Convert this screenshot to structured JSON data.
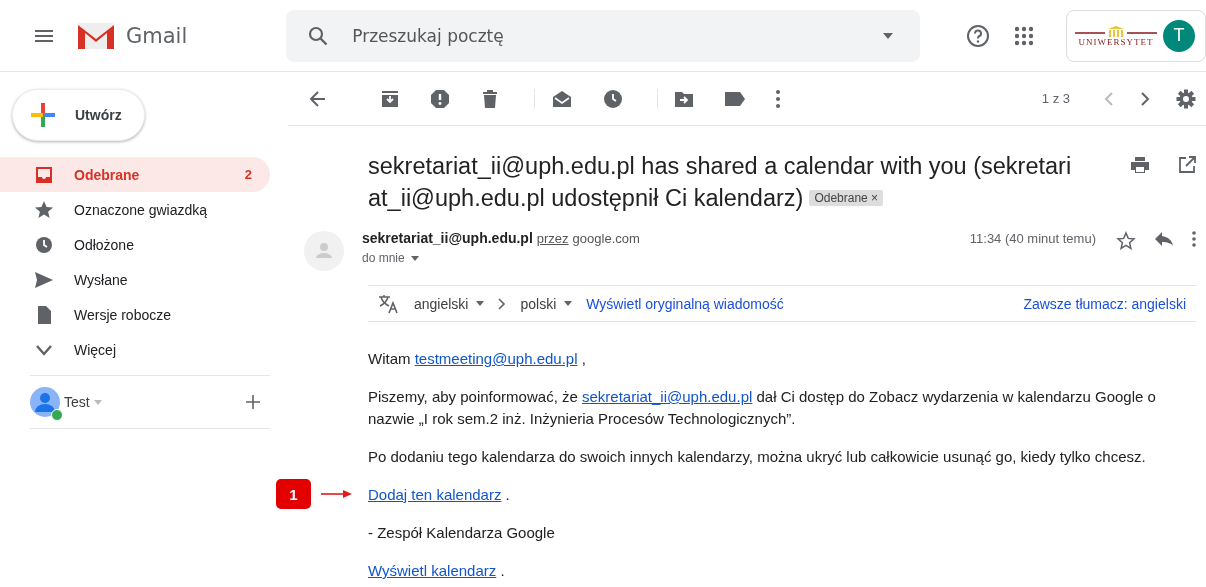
{
  "app": {
    "name": "Gmail"
  },
  "search": {
    "placeholder": "Przeszukaj pocztę"
  },
  "account": {
    "logo_text": "UNIWERSYTET",
    "avatar_initial": "T"
  },
  "compose": {
    "label": "Utwórz"
  },
  "sidebar": {
    "items": [
      {
        "label": "Odebrane",
        "count": "2",
        "selected": true
      },
      {
        "label": "Oznaczone gwiazdką",
        "selected": false
      },
      {
        "label": "Odłożone",
        "selected": false
      },
      {
        "label": "Wysłane",
        "selected": false
      },
      {
        "label": "Wersje robocze",
        "selected": false
      },
      {
        "label": "Więcej",
        "selected": false
      }
    ],
    "hangouts": {
      "user": "Test",
      "online": true
    }
  },
  "pager": "1 z 3",
  "email": {
    "subject_lines": [
      "sekretariat_ii@uph.edu.pl has shared a calendar with you (sekretari",
      "at_ii@uph.edu.pl udostępnił Ci kalendarz)"
    ],
    "label_chip": "Odebrane",
    "label_chip_close": "×",
    "sender": "sekretariat_ii@uph.edu.pl",
    "via_label": "przez",
    "via_domain": "google.com",
    "recipient": "do mnie",
    "time": "11:34 (40 minut temu)",
    "translation": {
      "from": "angielski",
      "to": "polski",
      "show_original": "Wyświetl oryginalną wiadomość",
      "always": "Zawsze tłumacz: angielski"
    },
    "paragraphs": [
      {
        "parts": [
          {
            "text": "Witam "
          },
          {
            "link": "testmeeting@uph.edu.pl"
          },
          {
            "text": " ,"
          }
        ]
      },
      {
        "parts": [
          {
            "text": "Piszemy, aby poinformować, że "
          },
          {
            "link": "sekretariat_ii@uph.edu.pl"
          },
          {
            "text": " dał Ci dostęp do Zobacz wydarzenia w kalendarzu Google o nazwie „I rok sem.2 inż. Inżynieria Procesów Technologicznych”."
          }
        ]
      },
      {
        "parts": [
          {
            "text": "Po dodaniu tego kalendarza do swoich innych kalendarzy, można ukryć lub całkowicie usunąć go, kiedy tylko chcesz."
          }
        ]
      },
      {
        "annotation": "1",
        "parts": [
          {
            "link": "Dodaj ten kalendarz"
          },
          {
            "text": " ."
          }
        ]
      },
      {
        "parts": [
          {
            "text": "- Zespół Kalendarza Google"
          }
        ]
      },
      {
        "parts": [
          {
            "link": "Wyświetl kalendarz"
          },
          {
            "text": " ."
          }
        ]
      }
    ]
  }
}
